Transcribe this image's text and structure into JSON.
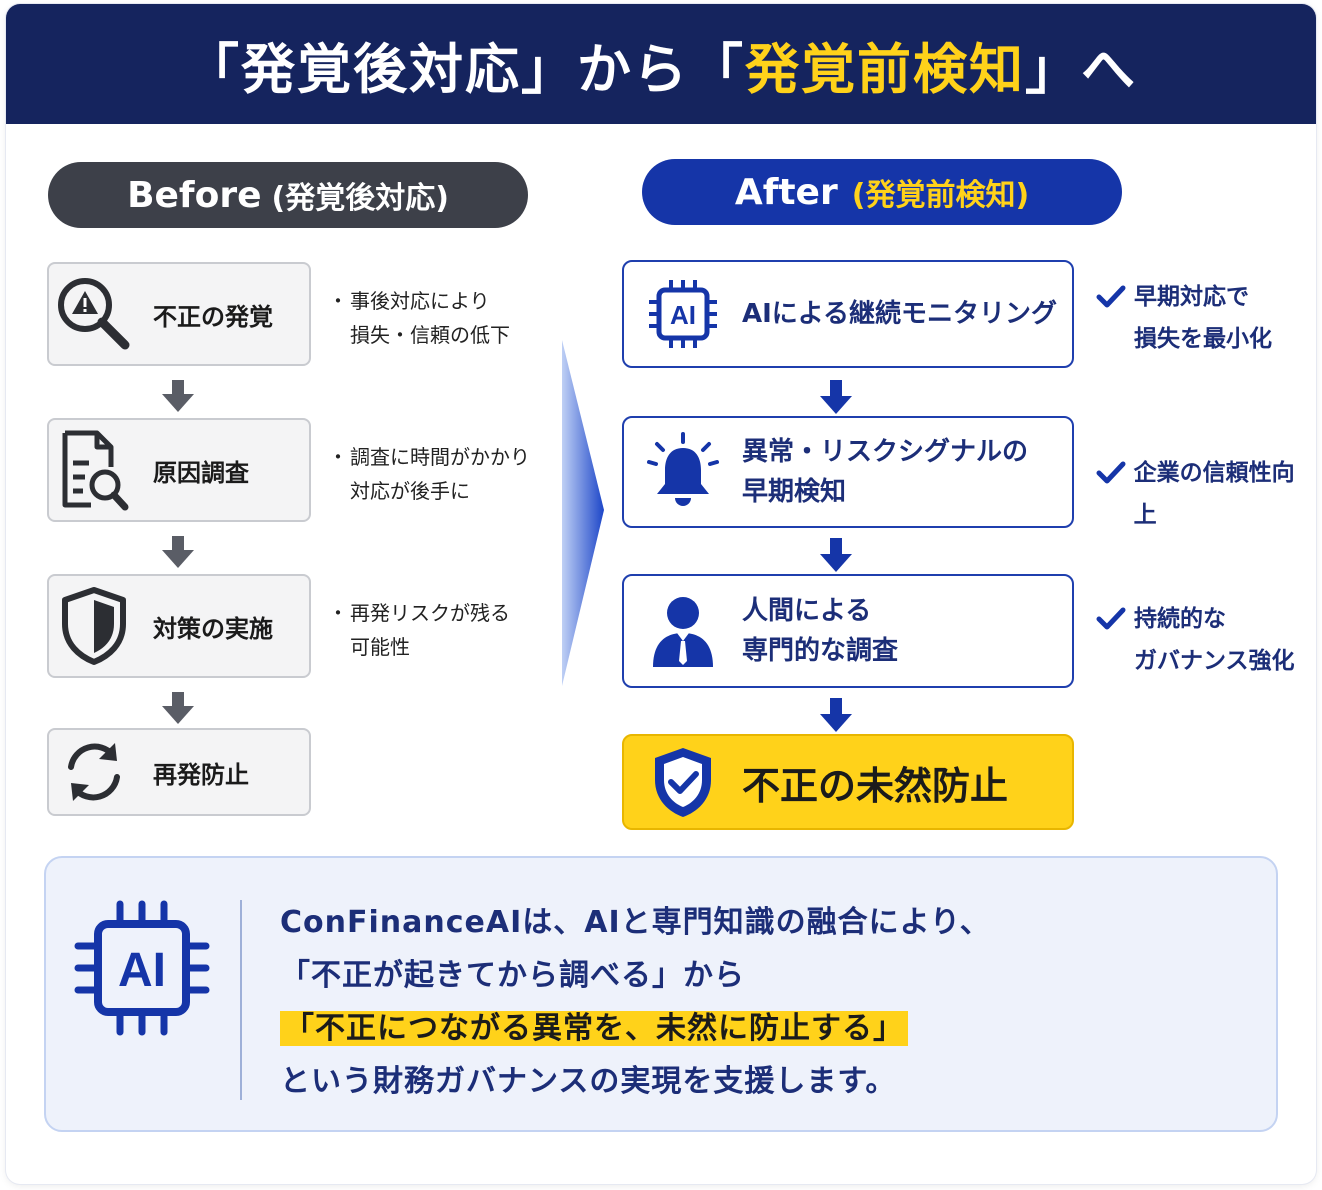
{
  "title": {
    "part1": "「発覚後対応」から「",
    "highlight": "発覚前検知",
    "part2": "」へ"
  },
  "before": {
    "header": "Before",
    "header_sub": "(発覚後対応)",
    "steps": [
      {
        "label": "不正の発覚",
        "icon": "warning-magnifier-icon",
        "note": [
          "事後対応により",
          "損失・信頼の低下"
        ]
      },
      {
        "label": "原因調査",
        "icon": "document-search-icon",
        "note": [
          "調査に時間がかかり",
          "対応が後手に"
        ]
      },
      {
        "label": "対策の実施",
        "icon": "shield-icon",
        "note": [
          "再発リスクが残る",
          "可能性"
        ]
      },
      {
        "label": "再発防止",
        "icon": "refresh-icon"
      }
    ]
  },
  "after": {
    "header": "After",
    "header_sub": "(発覚前検知)",
    "steps": [
      {
        "label": "AIによる継続モニタリング",
        "icon": "ai-chip-icon"
      },
      {
        "label": [
          "異常・リスクシグナルの",
          "早期検知"
        ],
        "icon": "alert-bell-icon"
      },
      {
        "label": [
          "人間による",
          "専門的な調査"
        ],
        "icon": "person-icon"
      }
    ],
    "final": {
      "label": "不正の未然防止",
      "icon": "shield-check-icon"
    },
    "benefits": [
      [
        "早期対応で",
        "損失を最小化"
      ],
      [
        "企業の信頼性向上"
      ],
      [
        "持続的な",
        "ガバナンス強化"
      ]
    ]
  },
  "summary": {
    "icon": "ai-chip-icon",
    "line1": "ConFinanceAIは、AIと専門知識の融合により、",
    "line2": "「不正が起きてから調べる」から",
    "line3": "「不正につながる異常を、未然に防止する」",
    "line4": "という財務ガバナンスの実現を支援します。"
  },
  "colors": {
    "navy": "#15245e",
    "blue": "#1535a8",
    "yellow": "#ffd21a",
    "dark_gray": "#3d4049",
    "text_navy": "#1c2e78"
  }
}
